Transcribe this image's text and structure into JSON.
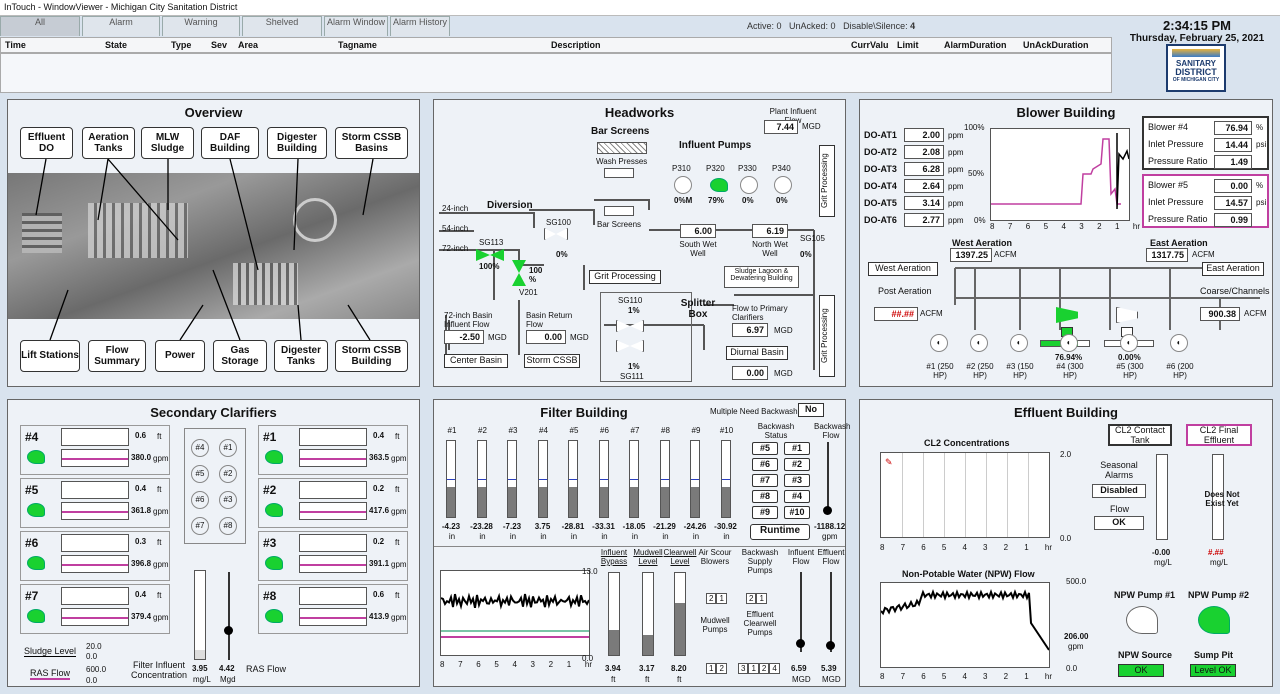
{
  "window": {
    "title": "InTouch - WindowViewer - Michigan City Sanitation District"
  },
  "alarm_tabs": [
    "All",
    "Alarm",
    "Warning",
    "Shelved",
    "Alarm Window",
    "Alarm History"
  ],
  "alarm_counts": {
    "active": "Active: 0",
    "unacked": "UnAcked: 0",
    "disable": "Disable\\Silence:",
    "disable_n": "4"
  },
  "alarm_columns": [
    "Time",
    "State",
    "Type",
    "Sev",
    "Area",
    "Tagname",
    "Description",
    "CurrValu",
    "Limit",
    "AlarmDuration",
    "UnAckDuration"
  ],
  "clock": {
    "time": "2:34:15 PM",
    "date": "Thursday, February 25, 2021"
  },
  "logo": {
    "l1": "SANITARY",
    "l2": "DISTRICT",
    "l3": "OF MICHIGAN CITY"
  },
  "overview": {
    "title": "Overview",
    "buttons": [
      "Effluent DO",
      "Aeration Tanks",
      "MLW Sludge",
      "DAF Building",
      "Digester Building",
      "Storm CSSB Basins",
      "Lift Stations",
      "Flow Summary",
      "Power",
      "Gas Storage",
      "Digester Tanks",
      "Storm CSSB Building"
    ]
  },
  "headworks": {
    "title": "Headworks",
    "plant_influent_label": "Plant Influent Flow",
    "plant_influent": "7.44",
    "mgd": "MGD",
    "bar_screens": "Bar Screens",
    "wash_presses": "Wash Presses",
    "bar_screens2": "Bar Screens",
    "influent_pumps": "Influent Pumps",
    "pumps": [
      "P310",
      "P320",
      "P330",
      "P340"
    ],
    "pump_pct": [
      "0",
      "79",
      "0",
      "0"
    ],
    "south": "6.00",
    "north": "6.19",
    "south_lbl": "South Wet Well",
    "north_lbl": "North Wet Well",
    "diversion": "Diversion",
    "in24": "24-inch",
    "in54": "54-inch",
    "in72": "72-inch",
    "sg113": "SG113",
    "sg113v": "100",
    "sg100": "SG100",
    "sg100v": "0",
    "v201": "V201",
    "v201v": "100",
    "sg105": "SG105",
    "sg105v": "0",
    "grit1": "Grit Processing",
    "grit2": "Grit Processing",
    "grit3": "Grit Processing",
    "sludge_lagoon": "Sludge Lagoon & Dewatering Building",
    "splitter": "Splitter Box",
    "sg110": "SG110",
    "sg110v": "1",
    "sg111": "SG111",
    "sg111v": "1",
    "flow_primary": "Flow to Primary Clarifiers",
    "flow_primary_v": "6.97",
    "diurnal": "Diurnal Basin",
    "diurnal_v": "0.00",
    "basin72": "72-inch Basin Influent Flow",
    "basin72_v": "-2.50",
    "return_lbl": "Basin Return Flow",
    "return_v": "0.00",
    "center": "Center Basin",
    "storm": "Storm CSSB"
  },
  "blower": {
    "title": "Blower Building",
    "do": [
      [
        "DO-AT1",
        "2.00"
      ],
      [
        "DO-AT2",
        "2.08"
      ],
      [
        "DO-AT3",
        "6.28"
      ],
      [
        "DO-AT4",
        "2.64"
      ],
      [
        "DO-AT5",
        "3.14"
      ],
      [
        "DO-AT6",
        "2.77"
      ]
    ],
    "ppm": "ppm",
    "b4": {
      "title": "Blower #4",
      "v1": "76.94",
      "u1": "%",
      "l2": "Inlet Pressure",
      "v2": "14.44",
      "u2": "psi",
      "l3": "Pressure Ratio",
      "v3": "1.49"
    },
    "b5": {
      "title": "Blower #5",
      "v1": "0.00",
      "u1": "%",
      "l2": "Inlet Pressure",
      "v2": "14.57",
      "u2": "psi",
      "l3": "Pressure Ratio",
      "v3": "0.99"
    },
    "west": "West Aeration",
    "west_v": "1397.25",
    "east": "East Aeration",
    "east_v": "1317.75",
    "acfm": "ACFM",
    "post": "Post Aeration",
    "post_v": "##.##",
    "coarse": "Coarse/Channels",
    "coarse_v": "900.38",
    "west_btn": "West Aeration",
    "east_btn": "East Aeration",
    "blowers": [
      "#1 (250 HP)",
      "#2 (250 HP)",
      "#3 (150 HP)",
      "#4 (300 HP)",
      "#5 (300 HP)",
      "#6 (200 HP)"
    ],
    "b4pct": "76.94",
    "b5pct": "0.00",
    "axis_y": [
      "100%",
      "50%",
      "0%"
    ],
    "axis_x": [
      "8",
      "7",
      "6",
      "5",
      "4",
      "3",
      "2",
      "1",
      "hr"
    ]
  },
  "clarifiers": {
    "title": "Secondary Clarifiers",
    "items": [
      [
        "#4",
        "0.6",
        "380.0"
      ],
      [
        "#5",
        "0.4",
        "361.8"
      ],
      [
        "#6",
        "0.3",
        "396.8"
      ],
      [
        "#7",
        "0.4",
        "379.4"
      ],
      [
        "#1",
        "0.4",
        "363.5"
      ],
      [
        "#2",
        "0.2",
        "417.6"
      ],
      [
        "#3",
        "0.2",
        "391.1"
      ],
      [
        "#8",
        "0.6",
        "413.9"
      ]
    ],
    "ft": "ft",
    "gpm": "gpm",
    "circles": [
      "#4",
      "#1",
      "#5",
      "#2",
      "#6",
      "#3",
      "#7",
      "#8"
    ],
    "sludge": "Sludge Level",
    "ras": "RAS Flow",
    "s_hi": "20.0",
    "s_lo": "0.0",
    "r_hi": "600.0",
    "r_lo": "0.0",
    "fic": "Filter Influent Concentration",
    "fic_v": "3.95",
    "fic_u": "mg/L",
    "ras_v": "4.42",
    "ras_u": "Mgd",
    "ras_lbl": "RAS Flow"
  },
  "filter": {
    "title": "Filter Building",
    "mnb": "Multiple Need Backwash",
    "mnb_v": "No",
    "cols": [
      "#1",
      "#2",
      "#3",
      "#4",
      "#5",
      "#6",
      "#7",
      "#8",
      "#9",
      "#10"
    ],
    "levels": [
      40,
      40,
      40,
      40,
      40,
      40,
      40,
      40,
      40,
      40
    ],
    "vals": [
      "-4.23",
      "-23.28",
      "-7.23",
      "3.75",
      "-28.81",
      "-33.31",
      "-18.05",
      "-21.29",
      "-24.26",
      "-30.92"
    ],
    "in": "in",
    "bw_status": "Backwash Status",
    "bw_flow": "Backwash Flow",
    "bw_flow_v": "-1188.12",
    "gpm": "gpm",
    "bw": [
      "#5",
      "#1",
      "#6",
      "#2",
      "#7",
      "#3",
      "#8",
      "#4",
      "#9",
      "#10"
    ],
    "runtime": "Runtime",
    "trend_max": "13.0",
    "trend_min": "0.0",
    "axis_x": [
      "8",
      "7",
      "6",
      "5",
      "4",
      "3",
      "2",
      "1",
      "hr"
    ],
    "ib": "Influent Bypass",
    "ib_v": "3.94",
    "ml": "Mudwell Level",
    "ml_v": "3.17",
    "cl": "Clearwell Level",
    "cl_v": "8.20",
    "ft": "ft",
    "asb": "Air Scour Blowers",
    "bsp": "Backwash Supply Pumps",
    "mp": "Mudwell Pumps",
    "ecp": "Effluent Clearwell Pumps",
    "if": "Influent Flow",
    "if_v": "6.59",
    "ef": "Effluent Flow",
    "ef_v": "5.39",
    "mgd": "MGD"
  },
  "effluent": {
    "title": "Effluent Building",
    "cl2": "CL2 Concentrations",
    "cl2_max": "2.0",
    "cl2_min": "0.0",
    "axis_x": [
      "8",
      "7",
      "6",
      "5",
      "4",
      "3",
      "2",
      "1",
      "hr"
    ],
    "seasonal": "Seasonal Alarms",
    "seasonal_v": "Disabled",
    "flow": "Flow",
    "flow_v": "OK",
    "cct": "CL2 Contact Tank",
    "cfe": "CL2 Final Effluent",
    "cct_v": "-0.00",
    "cfe_v": "#.##",
    "mgl": "mg/L",
    "dne": "Does Not Exist Yet",
    "npw": "Non-Potable Water (NPW) Flow",
    "npw_max": "500.0",
    "npw_min": "0.0",
    "npw_v": "206.00",
    "gpm": "gpm",
    "p1": "NPW Pump #1",
    "p2": "NPW Pump #2",
    "src": "NPW Source",
    "src_v": "OK",
    "sump": "Sump Pit",
    "sump_v": "Level OK"
  }
}
